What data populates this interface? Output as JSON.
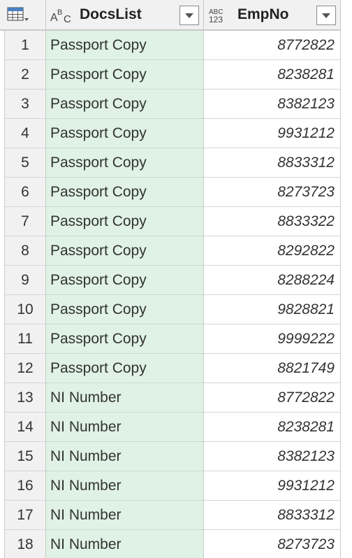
{
  "columns": {
    "docs": {
      "title": "DocsList",
      "type_icon": "text-type-icon"
    },
    "emp": {
      "title": "EmpNo",
      "type_icon": "any-type-icon"
    }
  },
  "rows": [
    {
      "n": "1",
      "doc": "Passport Copy",
      "emp": "8772822"
    },
    {
      "n": "2",
      "doc": "Passport Copy",
      "emp": "8238281"
    },
    {
      "n": "3",
      "doc": "Passport Copy",
      "emp": "8382123"
    },
    {
      "n": "4",
      "doc": "Passport Copy",
      "emp": "9931212"
    },
    {
      "n": "5",
      "doc": "Passport Copy",
      "emp": "8833312"
    },
    {
      "n": "6",
      "doc": "Passport Copy",
      "emp": "8273723"
    },
    {
      "n": "7",
      "doc": "Passport Copy",
      "emp": "8833322"
    },
    {
      "n": "8",
      "doc": "Passport Copy",
      "emp": "8292822"
    },
    {
      "n": "9",
      "doc": "Passport Copy",
      "emp": "8288224"
    },
    {
      "n": "10",
      "doc": "Passport Copy",
      "emp": "9828821"
    },
    {
      "n": "11",
      "doc": "Passport Copy",
      "emp": "9999222"
    },
    {
      "n": "12",
      "doc": "Passport Copy",
      "emp": "8821749"
    },
    {
      "n": "13",
      "doc": "NI Number",
      "emp": "8772822"
    },
    {
      "n": "14",
      "doc": "NI Number",
      "emp": "8238281"
    },
    {
      "n": "15",
      "doc": "NI Number",
      "emp": "8382123"
    },
    {
      "n": "16",
      "doc": "NI Number",
      "emp": "9931212"
    },
    {
      "n": "17",
      "doc": "NI Number",
      "emp": "8833312"
    },
    {
      "n": "18",
      "doc": "NI Number",
      "emp": "8273723"
    }
  ],
  "colors": {
    "selected_column": "#dff2e5",
    "header": "#f1f1f1",
    "grid_line": "#c9c9c9"
  }
}
